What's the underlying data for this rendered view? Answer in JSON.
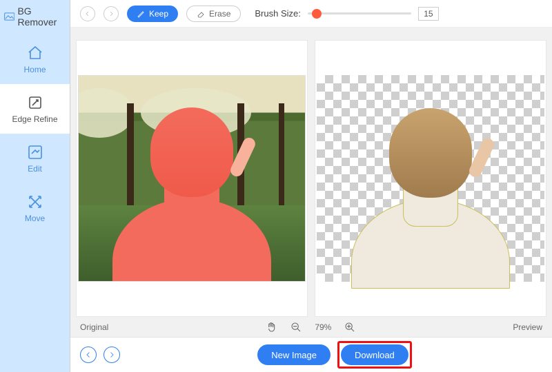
{
  "brand": {
    "name": "BG Remover"
  },
  "sidebar": {
    "items": [
      {
        "label": "Home",
        "icon": "home"
      },
      {
        "label": "Edge Refine",
        "icon": "edge-refine"
      },
      {
        "label": "Edit",
        "icon": "edit"
      },
      {
        "label": "Move",
        "icon": "move"
      }
    ]
  },
  "toolbar": {
    "keep_label": "Keep",
    "erase_label": "Erase",
    "brush_label": "Brush Size:",
    "brush_value": "15"
  },
  "panes": {
    "left_label": "Original",
    "right_label": "Preview"
  },
  "status": {
    "zoom": "79%"
  },
  "actions": {
    "new_image_label": "New Image",
    "download_label": "Download"
  },
  "colors": {
    "accent": "#2f7ff2",
    "mask_overlay": "#f36b5c",
    "slider_thumb": "#ff5a3c",
    "highlight_box": "#e11"
  }
}
